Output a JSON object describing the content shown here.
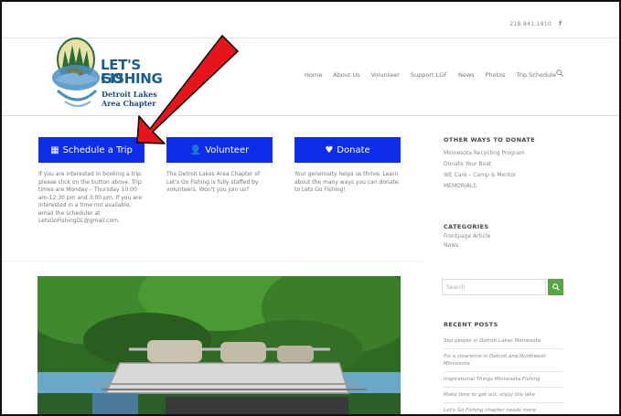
{
  "header": {
    "phone": "218.841.1910",
    "facebook": "f"
  },
  "logo": {
    "line1": "LET'S GO",
    "line2": "FISHING",
    "line3": "Detroit Lakes",
    "line4": "Area Chapter"
  },
  "nav": {
    "items": [
      "Home",
      "About Us",
      "Volunteer",
      "Support LGF",
      "News",
      "Photos",
      "Trip Schedule"
    ],
    "search_icon": "search-icon"
  },
  "buttons": {
    "schedule": "Schedule a Trip",
    "volunteer": "Volunteer",
    "donate": "Donate"
  },
  "descriptions": {
    "schedule": "If you are interested in booking a trip, please click on the button above. Trip times are Monday – Thursday 10:00 am-12:30 pm and 3:00 pm. If you are interested in a time not available, email the scheduler at LetsGoFishingDL@gmail.com.",
    "volunteer": "The Detroit Lakes Area Chapter of Let's Go Fishing is fully staffed by volunteers. Won't you join us?",
    "donate": "Your generosity helps us thrive. Learn about the many ways you can donate to Lets Go Fishing!"
  },
  "sidebar": {
    "donate_title": "OTHER WAYS TO DONATE",
    "donate_links": [
      "Minnesota Recycling Program",
      "Donate Your Boat",
      "WE Care – Camp & Mentor",
      "MEMORIALS"
    ],
    "categories_title": "CATEGORIES",
    "categories": [
      "Frontpage Article",
      "News"
    ],
    "search_placeholder": "Search",
    "recent_title": "RECENT POSTS",
    "recent_posts": [
      "Seo people in Detroit Lakes Minnesota",
      "Fix a clearance in Detroit and Northwest Minnesota",
      "Inspirational Things Minnesota Fishing",
      "Make time to get out, enjoy the lake",
      "Let's Go Fishing chapter needs more volunteers"
    ]
  },
  "colors": {
    "button_blue": "#0d2de8",
    "search_green": "#5aa348",
    "arrow_red": "#e8141c",
    "logo_blue": "#1a5e8e"
  }
}
